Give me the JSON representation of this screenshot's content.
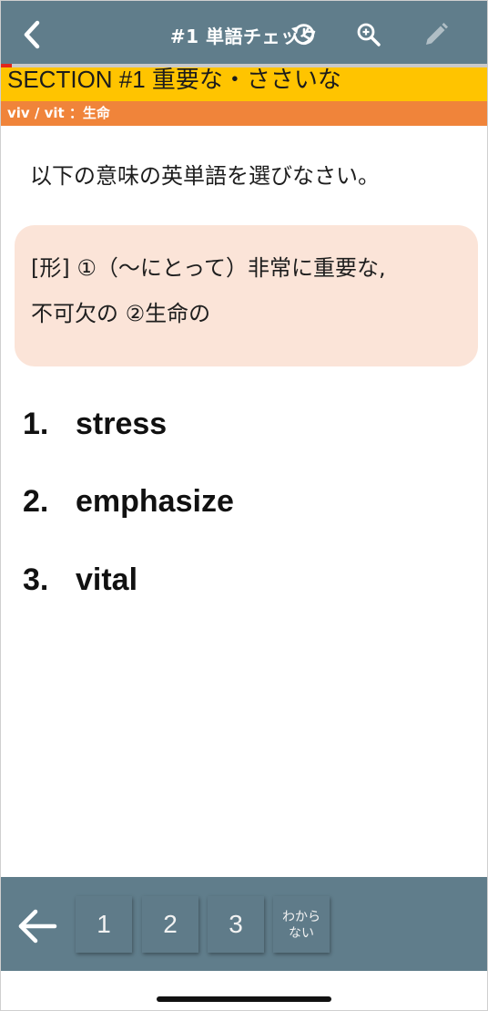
{
  "header": {
    "title": "#1 単語チェック",
    "icons": [
      "chevron-left-icon",
      "history-icon",
      "zoom-in-icon",
      "pencil-icon"
    ],
    "background": "#607d8b"
  },
  "progress": {
    "fraction": 0.025,
    "color": "#e1251b"
  },
  "section": {
    "label": "SECTION #1 重要な・ささいな",
    "color": "#ffc400"
  },
  "etymology": {
    "text": "viv / vit ：生命",
    "color": "#f0843a"
  },
  "question": {
    "instruction": "以下の意味の英単語を選びなさい。",
    "meaning_line1": "[形] ①（〜にとって）非常に重要な,",
    "meaning_line2": "不可欠の ②生命の"
  },
  "choices": [
    {
      "number": "1.",
      "word": "stress"
    },
    {
      "number": "2.",
      "word": "emphasize"
    },
    {
      "number": "3.",
      "word": "vital"
    }
  ],
  "answer_bar": {
    "buttons": [
      "1",
      "2",
      "3"
    ],
    "unknown_label": "わから\nない"
  }
}
